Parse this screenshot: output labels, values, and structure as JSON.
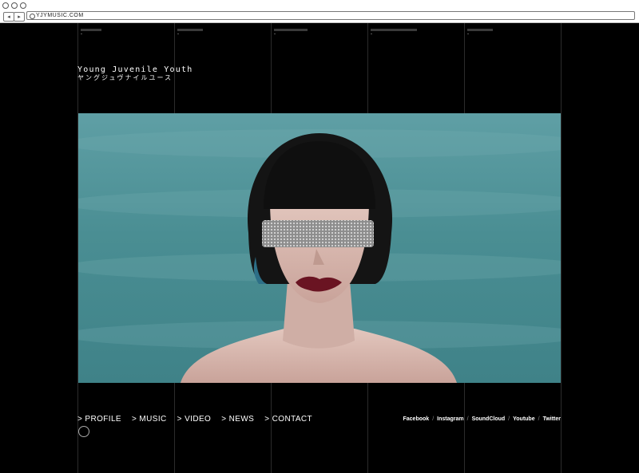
{
  "browser": {
    "url": "YJYMUSIC.COM",
    "back_icon": "chevron-left-icon",
    "forward_icon": "chevron-right-icon"
  },
  "logo": {
    "en": "Young Juvenile Youth",
    "jp": "ヤングジュヴナイルユース"
  },
  "nav": {
    "items": [
      "> PROFILE",
      "> MUSIC",
      "> VIDEO",
      "> NEWS",
      "> CONTACT"
    ]
  },
  "social": {
    "items": [
      "Facebook",
      "Instagram",
      "SoundCloud",
      "Youtube",
      "Twitter"
    ],
    "separator": "/"
  },
  "colors": {
    "background": "#000000",
    "hero_teal": "#4a8e93",
    "text": "#ffffff"
  }
}
